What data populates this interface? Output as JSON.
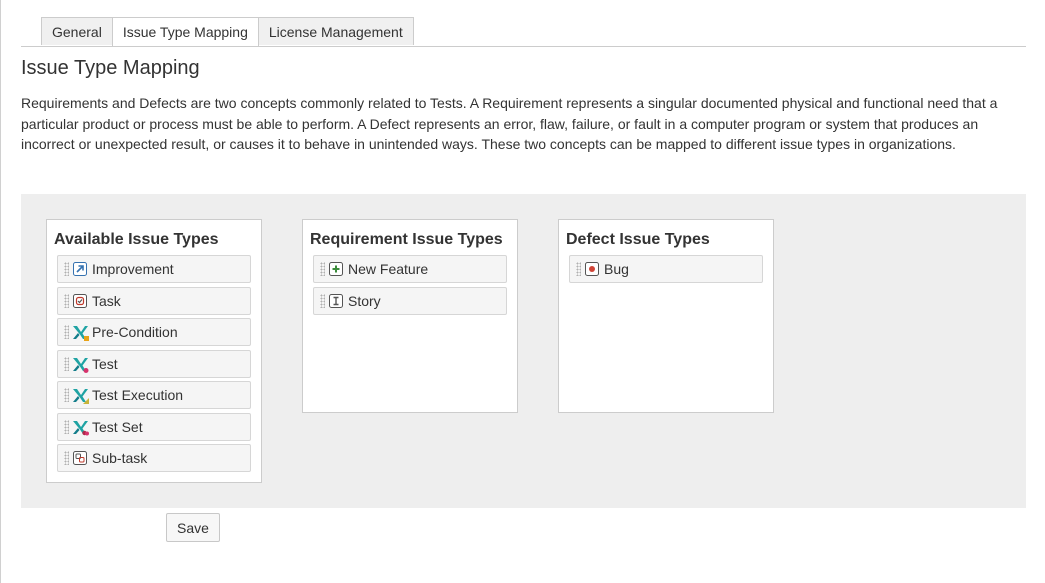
{
  "tabs": [
    {
      "label": "General"
    },
    {
      "label": "Issue Type Mapping"
    },
    {
      "label": "License Management"
    }
  ],
  "page_title": "Issue Type Mapping",
  "description": "Requirements and Defects are two concepts commonly related to Tests. A Requirement represents a singular documented physical and functional need that a particular product or process must be able to perform. A Defect represents an error, flaw, failure, or fault in a computer program or system that produces an incorrect or unexpected result, or causes it to behave in unintended ways. These two concepts can be mapped to different issue types in organizations.",
  "lists": {
    "available": {
      "title": "Available Issue Types",
      "items": [
        {
          "label": "Improvement",
          "icon": "improvement-icon"
        },
        {
          "label": "Task",
          "icon": "task-icon"
        },
        {
          "label": "Pre-Condition",
          "icon": "pre-condition-icon"
        },
        {
          "label": "Test",
          "icon": "test-icon"
        },
        {
          "label": "Test Execution",
          "icon": "test-execution-icon"
        },
        {
          "label": "Test Set",
          "icon": "test-set-icon"
        },
        {
          "label": "Sub-task",
          "icon": "sub-task-icon"
        }
      ]
    },
    "requirement": {
      "title": "Requirement Issue Types",
      "items": [
        {
          "label": "New Feature",
          "icon": "new-feature-icon"
        },
        {
          "label": "Story",
          "icon": "story-icon"
        }
      ]
    },
    "defect": {
      "title": "Defect Issue Types",
      "items": [
        {
          "label": "Bug",
          "icon": "bug-icon"
        }
      ]
    }
  },
  "save_label": "Save",
  "colors": {
    "panel_background": "#eeeeee",
    "xray_teal": "#1fa3a3",
    "bug_red": "#d04437",
    "new_feature_green": "#3b8c3b"
  }
}
